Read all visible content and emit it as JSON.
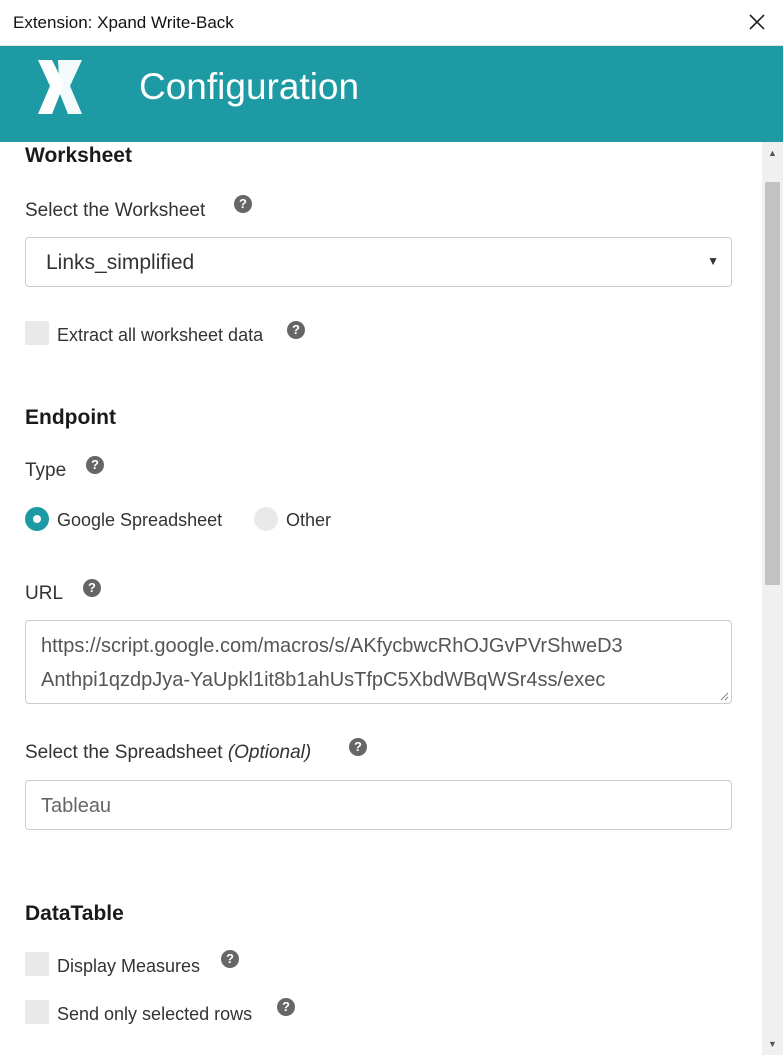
{
  "window": {
    "title": "Extension: Xpand Write-Back"
  },
  "header": {
    "title": "Configuration"
  },
  "worksheet": {
    "section_title": "Worksheet",
    "select_label": "Select the Worksheet",
    "selected_value": "Links_simplified",
    "extract_all_label": "Extract all worksheet data",
    "extract_all_checked": false
  },
  "endpoint": {
    "section_title": "Endpoint",
    "type_label": "Type",
    "type_options": [
      "Google Spreadsheet",
      "Other"
    ],
    "type_selected": "Google Spreadsheet",
    "url_label": "URL",
    "url_line1": "https://script.google.com/macros/s/AKfycbwcRhOJGvPVrShweD3",
    "url_line2": "Anthpi1qzdpJya-YaUpkl1it8b1ahUsTfpC5XbdWBqWSr4ss/exec",
    "spreadsheet_label": "Select the Spreadsheet",
    "spreadsheet_optional": "(Optional)",
    "spreadsheet_value": "Tableau"
  },
  "datatable": {
    "section_title": "DataTable",
    "display_measures_label": "Display Measures",
    "display_measures_checked": false,
    "send_selected_label": "Send only selected rows",
    "send_selected_checked": false
  },
  "icons": {
    "help": "?",
    "caret": "▼",
    "scroll_up": "▲",
    "scroll_down": "▼"
  },
  "colors": {
    "accent": "#1e9aa5",
    "header_text": "#ffffff"
  }
}
